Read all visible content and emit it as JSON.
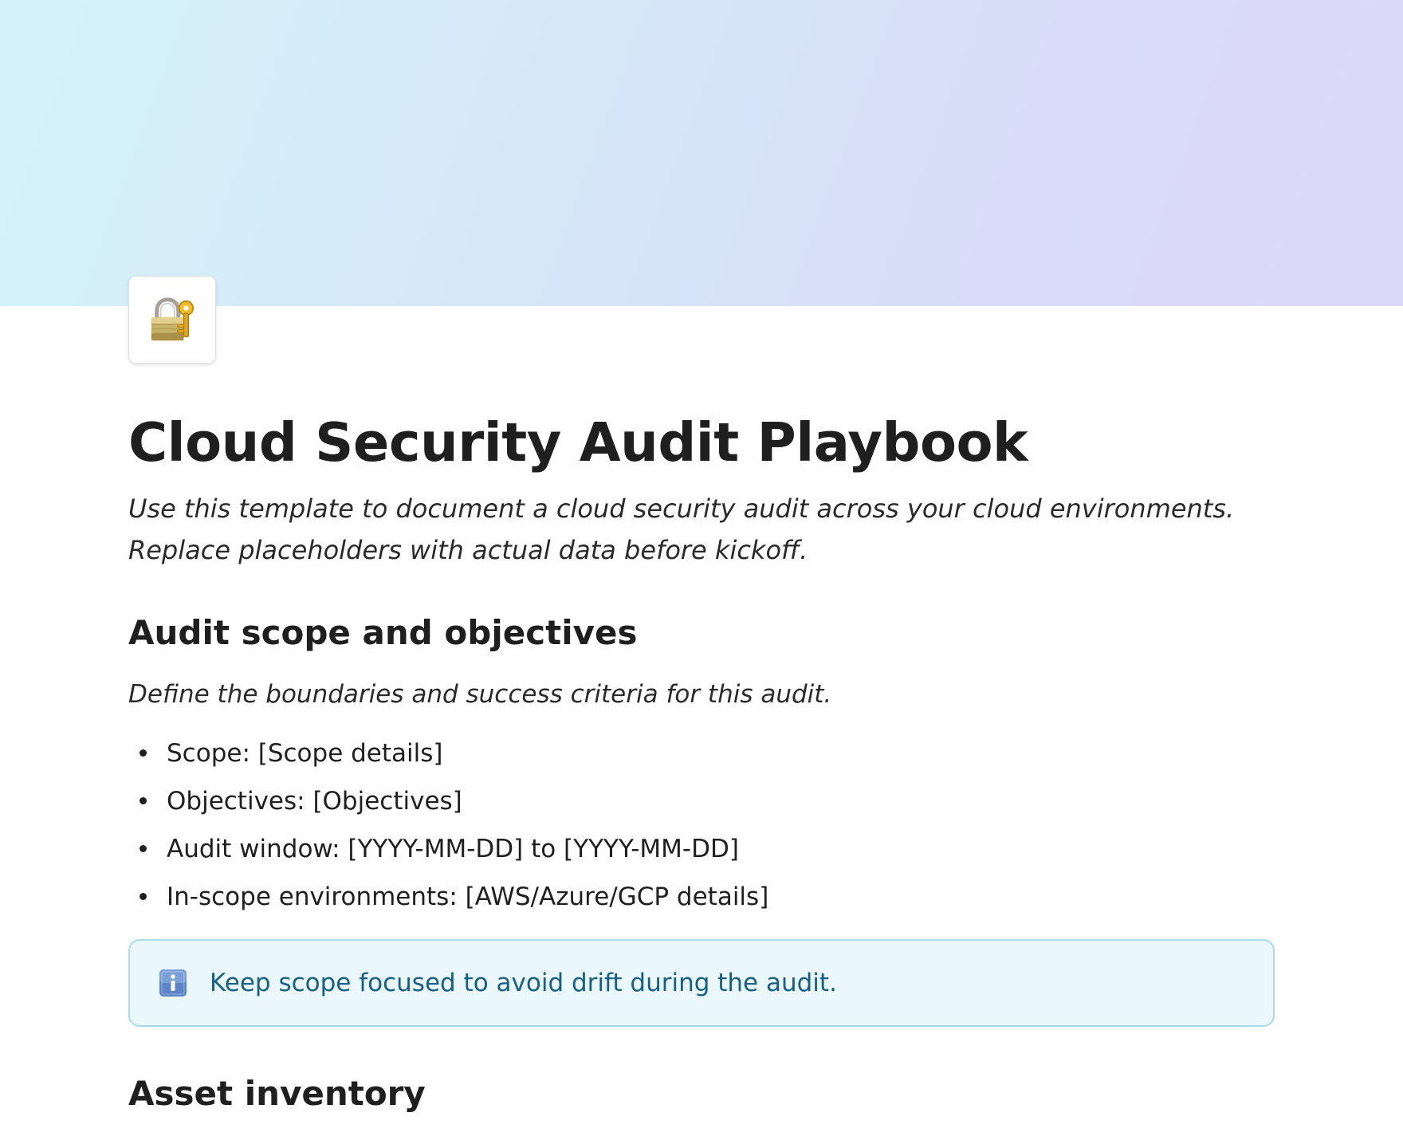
{
  "page": {
    "icon": "lock-with-key-icon",
    "title": "Cloud Security Audit Playbook",
    "subtitle": "Use this template to document a cloud security audit across your cloud environments. Replace placeholders with actual data before kickoff."
  },
  "sections": [
    {
      "heading": "Audit scope and objectives",
      "description": "Define the boundaries and success criteria for this audit.",
      "items": [
        "Scope: [Scope details]",
        "Objectives: [Objectives]",
        "Audit window: [YYYY-MM-DD] to [YYYY-MM-DD]",
        "In-scope environments: [AWS/Azure/GCP details]"
      ],
      "callout": {
        "icon": "information-icon",
        "text": "Keep scope focused to avoid drift during the audit."
      }
    },
    {
      "heading": "Asset inventory"
    }
  ],
  "colors": {
    "cover_start": "#d4f3f8",
    "cover_end": "#dcd8f8",
    "callout_background": "#eaf7fd",
    "callout_border": "#a8dcef",
    "callout_text": "#165f85"
  }
}
